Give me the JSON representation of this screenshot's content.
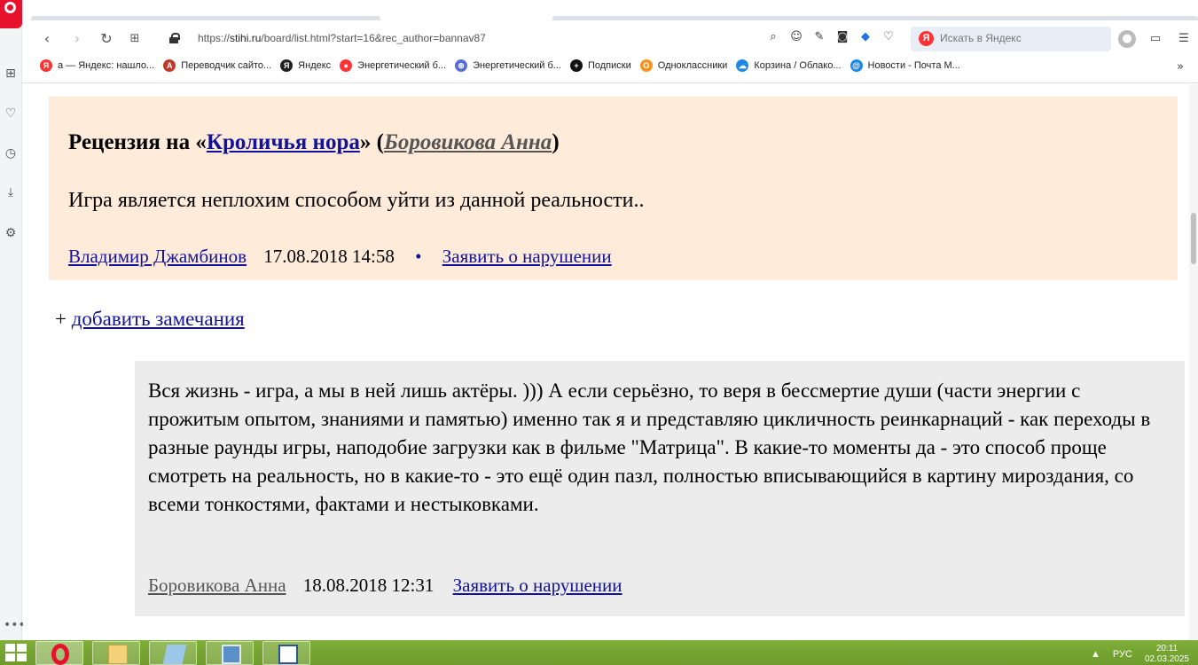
{
  "browser": {
    "url_prefix": "https://",
    "url_host": "stihi.ru",
    "url_path": "/board/list.html?start=16&rec_author=bannav87",
    "search_placeholder": "Искать в Яндекс",
    "search_logo": "Я",
    "bookmarks": [
      {
        "label": "а — Яндекс: нашло...",
        "icon": "yandex-icon",
        "color": "#f33",
        "glyph": "Я"
      },
      {
        "label": "Переводчик сайто...",
        "icon": "translator-icon",
        "color": "#c0392b",
        "glyph": "A"
      },
      {
        "label": "Яндекс",
        "icon": "yandex-icon",
        "color": "#222",
        "glyph": "Я"
      },
      {
        "label": "Энергетический б...",
        "icon": "map-pin-icon",
        "color": "#f33",
        "glyph": "●"
      },
      {
        "label": "Энергетический б...",
        "icon": "globe-icon",
        "color": "#5a6ed6",
        "glyph": "⊕"
      },
      {
        "label": "Подписки",
        "icon": "plus-icon",
        "color": "#111",
        "glyph": "+"
      },
      {
        "label": "Одноклассники",
        "icon": "ok-icon",
        "color": "#f7931e",
        "glyph": "О"
      },
      {
        "label": "Корзина / Облако...",
        "icon": "cloud-icon",
        "color": "#1e88e5",
        "glyph": "☁"
      },
      {
        "label": "Новости - Почта М...",
        "icon": "mail-icon",
        "color": "#1e88e5",
        "glyph": "@"
      }
    ],
    "bookmarks_more": "»"
  },
  "review": {
    "title_prefix": "Рецензия на «",
    "work_title": "Кроличья нора",
    "title_mid": "» (",
    "work_author": "Боровикова Анна",
    "title_suffix": ")",
    "text": "Игра является неплохим способом уйти из данной реальности..",
    "reviewer": "Владимир Джамбинов",
    "datetime": "17.08.2018 14:58",
    "separator": "•",
    "report_label": "Заявить о нарушении"
  },
  "add_remark": {
    "plus": "+",
    "label": "добавить замечания"
  },
  "reply": {
    "text": "Вся жизнь - игра, а мы в ней лишь актёры. ))) А если серьёзно, то веря в бессмертие души (части энергии с прожитым опытом, знаниями и памятью) именно так я и представляю цикличность реинкарнаций - как переходы в разные раунды игры, наподобие загрузки как в фильме \"Матрица\". В какие-то моменты да - это способ проще смотреть на реальность, но в какие-то - это ещё один пазл, полностью вписывающийся в картину мироздания, со всеми тонкостями, фактами и нестыковками.",
    "author": "Боровикова Анна",
    "datetime": "18.08.2018 12:31",
    "report_label": "Заявить о нарушении"
  },
  "taskbar": {
    "language": "РУС",
    "time": "20:11",
    "date": "02.03.2025"
  },
  "colors": {
    "review_bg": "#feebd9",
    "reply_bg": "#ececec",
    "link": "#111199",
    "taskbar": "#7fae3a"
  }
}
